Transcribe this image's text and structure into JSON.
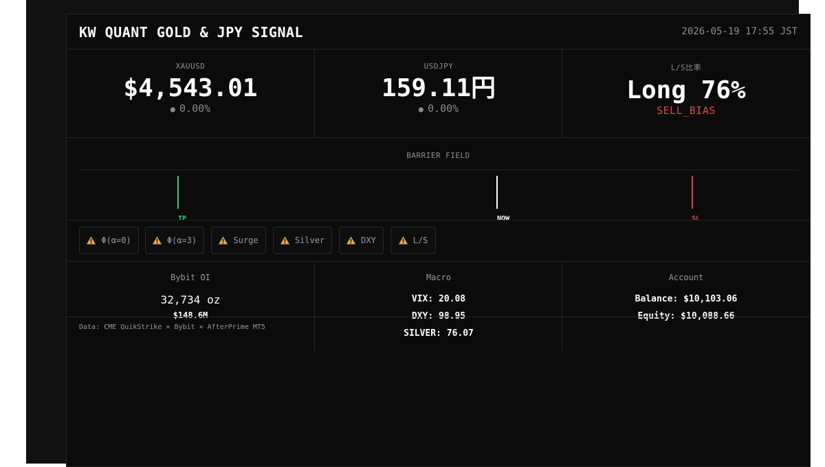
{
  "header": {
    "title": "KW QUANT GOLD & JPY SIGNAL",
    "datetime": "2026-05-19 17:55 JST"
  },
  "metrics": [
    {
      "label": "XAUUSD",
      "value": "$4,543.01",
      "change": "0.00%"
    },
    {
      "label": "USDJPY",
      "value": "159.11円",
      "change": "0.00%"
    },
    {
      "label": "L/S比率",
      "value": "Long 76%",
      "bias": "SELL_BIAS",
      "bias_color": "#e04646"
    }
  ],
  "barrier": {
    "title": "BARRIER FIELD",
    "markers": [
      {
        "label": "TP",
        "color": "#2ecc71"
      },
      {
        "label": "NOW",
        "color": "#ffffff"
      },
      {
        "label": "SL",
        "color": "#e04646"
      }
    ]
  },
  "alerts": [
    {
      "label": "Φ(α=0)",
      "icon": "warning-icon"
    },
    {
      "label": "Φ(α=3)",
      "icon": "warning-icon"
    },
    {
      "label": "Surge",
      "icon": "warning-icon"
    },
    {
      "label": "Silver",
      "icon": "warning-icon"
    },
    {
      "label": "DXY",
      "icon": "warning-icon"
    },
    {
      "label": "L/S",
      "icon": "warning-icon"
    }
  ],
  "cards": {
    "bybit": {
      "title": "Bybit OI",
      "oz": "32,734 oz",
      "usd": "$148.6M"
    },
    "macro": {
      "title": "Macro",
      "vix": "VIX: 20.08",
      "dxy": "DXY: 98.95",
      "silver": "SILVER: 76.07"
    },
    "account": {
      "title": "Account",
      "balance": "Balance: $10,103.06",
      "equity": "Equity: $10,088.66"
    }
  },
  "footer": {
    "source": "Data: CME QuikStrike × Bybit × AfterPrime MT5"
  },
  "colors": {
    "accent_green": "#2ecc71",
    "accent_red": "#e04646",
    "warning": "#f0a64a"
  }
}
